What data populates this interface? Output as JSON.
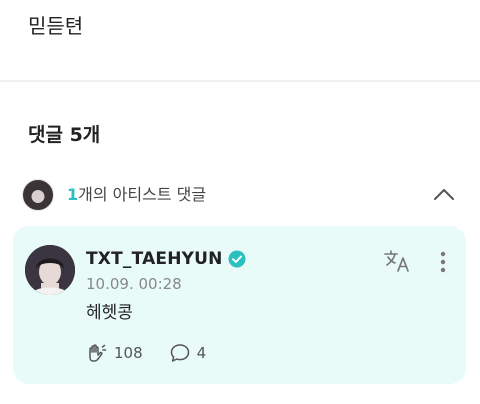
{
  "post": {
    "text": "믿듣텬"
  },
  "comments": {
    "heading": "댓글 5개"
  },
  "artist_section": {
    "count": "1",
    "label_suffix": "개의 아티스트 댓글"
  },
  "artist_comment": {
    "username": "TXT_TAEHYUN",
    "timestamp": "10.09. 00:28",
    "text": "헤헷콩",
    "likes": "108",
    "replies": "4"
  },
  "colors": {
    "accent": "#2bbfbf",
    "card_background": "#e8fbf8",
    "verified": "#2bbfbf"
  },
  "icons": {
    "collapse": "chevron-up-icon",
    "translate": "translate-icon",
    "more": "more-vertical-icon",
    "like": "cheer-hand-icon",
    "reply": "speech-bubble-icon",
    "verified": "verified-badge-icon"
  }
}
